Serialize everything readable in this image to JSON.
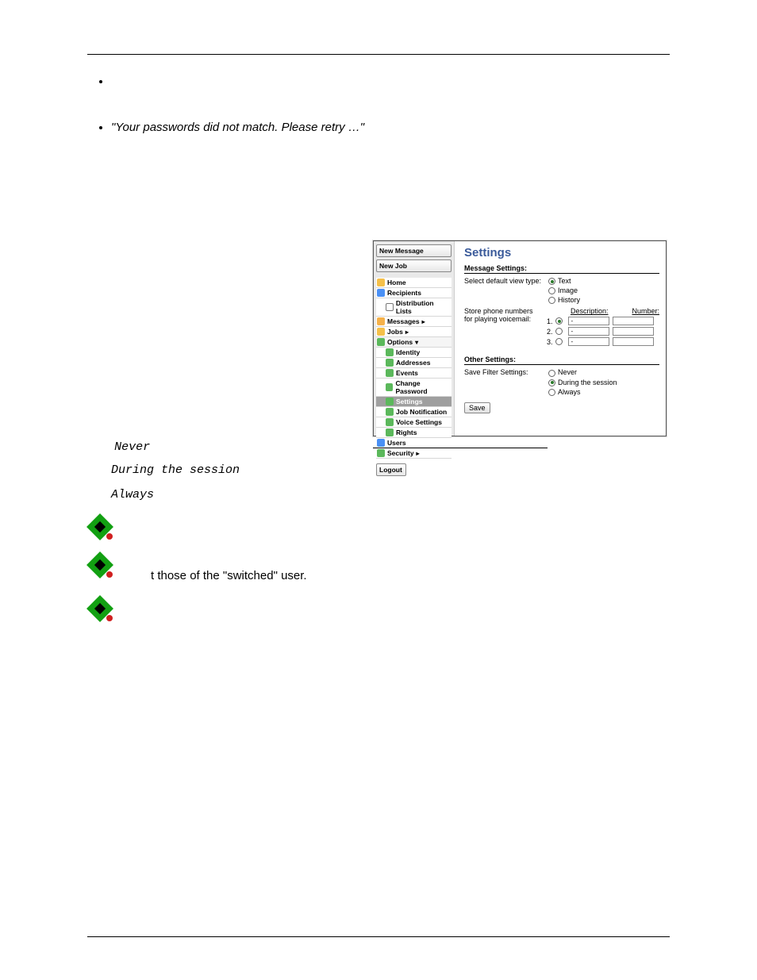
{
  "header": {
    "running": ""
  },
  "errors": {
    "bullet1": "",
    "quoted": "\"Your passwords did not match. Please retry …\""
  },
  "sectionTitle": "Settings",
  "intro": "",
  "figure": {
    "sidebar": {
      "btnNewMessage": "New Message",
      "btnNewJob": "New Job",
      "home": "Home",
      "recipients": "Recipients",
      "dist": "Distribution Lists",
      "messages": "Messages",
      "jobs": "Jobs",
      "options": "Options",
      "identity": "Identity",
      "addresses": "Addresses",
      "events": "Events",
      "changepw": "Change Password",
      "settings": "Settings",
      "jobnotif": "Job Notification",
      "voice": "Voice Settings",
      "rights": "Rights",
      "users": "Users",
      "security": "Security",
      "logout": "Logout"
    },
    "content": {
      "title": "Settings",
      "msgSettings": "Message Settings:",
      "defaultViewLabel": "Select default view type:",
      "optText": "Text",
      "optImage": "Image",
      "optHistory": "History",
      "storeLabel": "Store phone numbers for playing voicemail:",
      "descHdr": "Description:",
      "numHdr": "Number:",
      "row1": "1.",
      "row2": "2.",
      "row3": "3.",
      "dash": "-",
      "otherSettings": "Other Settings:",
      "saveFilterLabel": "Save Filter Settings:",
      "optNever": "Never",
      "optDuring": "During the session",
      "optAlways": "Always",
      "saveBtn": "Save"
    },
    "caption": ""
  },
  "lower": {
    "leadin": "",
    "never": "Never",
    "neverDesc": "",
    "during": "During the session",
    "duringDesc1": "",
    "duringDesc2": "",
    "always": "Always",
    "alwaysDesc": ""
  },
  "notes": {
    "n1": "",
    "n2": "t those of the \"switched\" user.",
    "n2hidden": "",
    "n3": ""
  },
  "footer": {
    "left": "",
    "right": ""
  },
  "chart_data": {
    "type": "table",
    "title": "Settings",
    "sections": [
      {
        "name": "Message Settings",
        "fields": [
          {
            "label": "Select default view type",
            "type": "radio",
            "options": [
              "Text",
              "Image",
              "History"
            ],
            "selected": "Text"
          },
          {
            "label": "Store phone numbers for playing voicemail",
            "type": "grid",
            "columns": [
              "Description",
              "Number"
            ],
            "rows": [
              [
                "-",
                ""
              ],
              [
                "-",
                ""
              ],
              [
                "-",
                ""
              ]
            ],
            "selectedRow": 1
          }
        ]
      },
      {
        "name": "Other Settings",
        "fields": [
          {
            "label": "Save Filter Settings",
            "type": "radio",
            "options": [
              "Never",
              "During the session",
              "Always"
            ],
            "selected": "During the session"
          }
        ]
      }
    ]
  }
}
